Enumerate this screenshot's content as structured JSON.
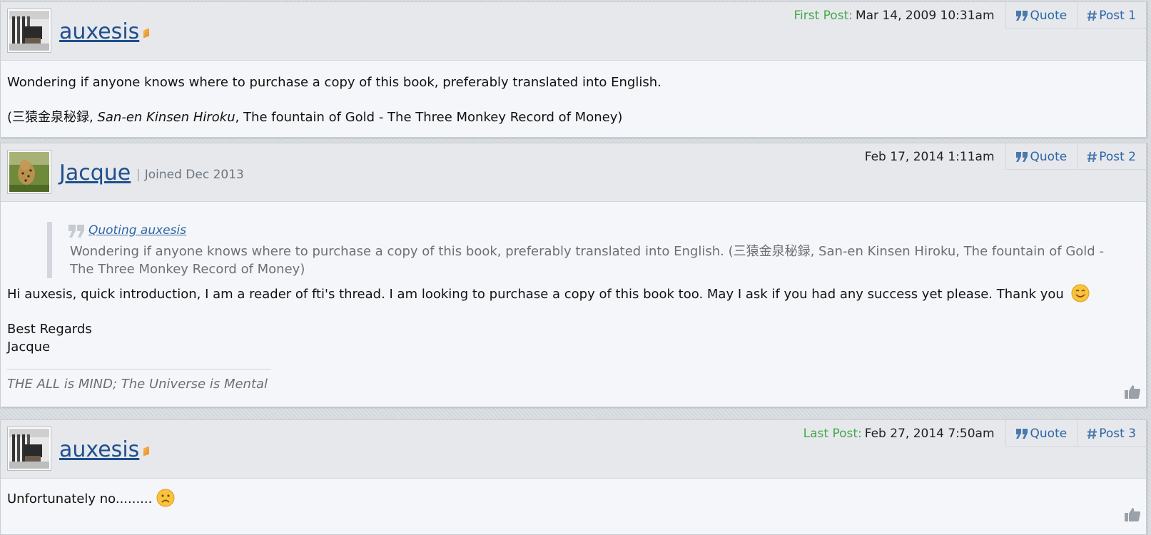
{
  "posts": [
    {
      "username": "auxesis",
      "date_label": "First Post:",
      "date": "Mar 14, 2009 10:31am",
      "quote_label": "Quote",
      "post_label": "Post 1",
      "body_line1": "Wondering if anyone knows where to purchase a copy of this book, preferably translated into English.",
      "body_line2_prefix": "(三猿金泉秘録, ",
      "body_line2_italic": "San-en Kinsen Hiroku",
      "body_line2_suffix": ", The fountain of Gold - The Three Monkey Record of Money)"
    },
    {
      "username": "Jacque",
      "joined_sep": "|",
      "joined": "Joined Dec 2013",
      "date": "Feb 17, 2014 1:11am",
      "quote_label": "Quote",
      "post_label": "Post 2",
      "quote_link": "Quoting auxesis",
      "quote_text_1": "Wondering if anyone knows where to purchase a copy of this book, preferably translated into English. (三猿金泉秘録, San-en Kinsen Hiroku, The fountain of Gold -",
      "quote_text_2": "The Three Monkey Record of Money)",
      "body_line1": "Hi auxesis, quick introduction, I am a reader of fti's thread. I am looking to purchase a copy of this book too. May I ask if you had any success yet please. Thank you",
      "body_line2": "Best Regards",
      "body_line3": "Jacque",
      "signature": "THE ALL is MIND; The Universe is Mental"
    },
    {
      "username": "auxesis",
      "date_label": "Last Post:",
      "date": "Feb 27, 2014 7:50am",
      "quote_label": "Quote",
      "post_label": "Post 3",
      "body_line1": "Unfortunately no........."
    }
  ],
  "icons": {
    "quote": "quote-icon",
    "hash": "hash-icon",
    "like": "thumbs-up-icon",
    "smile": "smile-emoji-icon",
    "frown": "frown-emoji-icon"
  },
  "colors": {
    "link": "#2d66a6",
    "username": "#1f4f8d",
    "first_last_label": "#45a84a",
    "header_bg": "#e6e8ec",
    "post_bg": "#f5f6f9"
  }
}
